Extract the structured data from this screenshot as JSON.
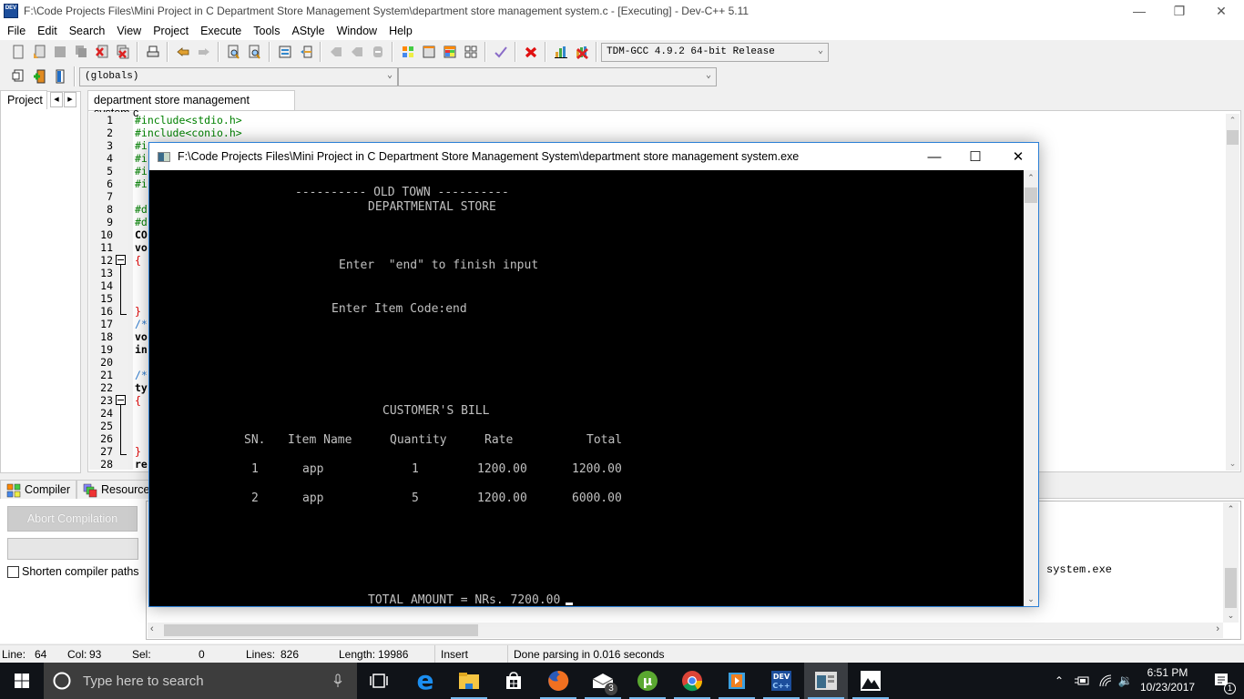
{
  "window": {
    "title": "F:\\Code Projects Files\\Mini Project in C Department Store Management System\\department store management system.c - [Executing] - Dev-C++ 5.11",
    "app_icon_text": "DEV"
  },
  "menu": [
    "File",
    "Edit",
    "Search",
    "View",
    "Project",
    "Execute",
    "Tools",
    "AStyle",
    "Window",
    "Help"
  ],
  "toolbar": {
    "compiler_select": "TDM-GCC 4.9.2 64-bit Release",
    "scope_select": "(globals)",
    "function_select": ""
  },
  "left_panel": {
    "tab_label": "Project"
  },
  "editor": {
    "tab_label": "department store management system.c",
    "lines": [
      {
        "n": "1",
        "code": "#include<stdio.h>",
        "cls": "pp"
      },
      {
        "n": "2",
        "code": "#include<conio.h>",
        "cls": "pp"
      },
      {
        "n": "3",
        "code": "#i",
        "cls": "pp"
      },
      {
        "n": "4",
        "code": "#i",
        "cls": "pp"
      },
      {
        "n": "5",
        "code": "#i",
        "cls": "pp"
      },
      {
        "n": "6",
        "code": "#i",
        "cls": "pp"
      },
      {
        "n": "7",
        "code": "",
        "cls": ""
      },
      {
        "n": "8",
        "code": "#d",
        "cls": "pp"
      },
      {
        "n": "9",
        "code": "#d",
        "cls": "pp"
      },
      {
        "n": "10",
        "code": "CO",
        "cls": "id"
      },
      {
        "n": "11",
        "code": "vo",
        "cls": "kw"
      },
      {
        "n": "12",
        "code": "{",
        "cls": "br"
      },
      {
        "n": "13",
        "code": "",
        "cls": ""
      },
      {
        "n": "14",
        "code": "",
        "cls": ""
      },
      {
        "n": "15",
        "code": "",
        "cls": ""
      },
      {
        "n": "16",
        "code": "}",
        "cls": "br"
      },
      {
        "n": "17",
        "code": "/*",
        "cls": "cm"
      },
      {
        "n": "18",
        "code": "vo",
        "cls": "kw"
      },
      {
        "n": "19",
        "code": "in",
        "cls": "kw"
      },
      {
        "n": "20",
        "code": "",
        "cls": ""
      },
      {
        "n": "21",
        "code": "/*",
        "cls": "cm"
      },
      {
        "n": "22",
        "code": "ty",
        "cls": "kw"
      },
      {
        "n": "23",
        "code": "{",
        "cls": "br"
      },
      {
        "n": "24",
        "code": "",
        "cls": ""
      },
      {
        "n": "25",
        "code": "",
        "cls": ""
      },
      {
        "n": "26",
        "code": "",
        "cls": ""
      },
      {
        "n": "27",
        "code": "}",
        "cls": "br"
      },
      {
        "n": "28",
        "code": "re",
        "cls": "id"
      }
    ]
  },
  "bottom_panel": {
    "tabs": [
      "Compiler",
      "Resources"
    ],
    "abort_button": "Abort Compilation",
    "shorten_paths_label": "Shorten compiler paths",
    "shorten_paths_checked": false,
    "log_text": "system.exe"
  },
  "statusbar": {
    "line_label": "Line:",
    "line": "64",
    "col_label": "Col:",
    "col": "93",
    "sel_label": "Sel:",
    "sel": "0",
    "lines_label": "Lines:",
    "lines": "826",
    "length_label": "Length:",
    "length": "19986",
    "mode": "Insert",
    "message": "Done parsing in 0.016 seconds"
  },
  "console": {
    "title": "F:\\Code Projects Files\\Mini Project in C Department Store Management System\\department store management system.exe",
    "header1": "---------- OLD TOWN ----------",
    "header2": "DEPARTMENTAL STORE",
    "instruction": "Enter  \"end\" to finish input",
    "prompt": "Enter Item Code:end",
    "bill_title": "CUSTOMER'S BILL",
    "columns": [
      "SN.",
      "Item Name",
      "Quantity",
      "Rate",
      "Total"
    ],
    "rows": [
      [
        "1",
        "app",
        "1",
        "1200.00",
        "1200.00"
      ],
      [
        "2",
        "app",
        "5",
        "1200.00",
        "6000.00"
      ]
    ],
    "total_line": "TOTAL AMOUNT = NRs. 7200.00"
  },
  "taskbar": {
    "search_placeholder": "Type here to search",
    "mail_badge": "3",
    "time": "6:51 PM",
    "date": "10/23/2017",
    "notification_badge": "1"
  }
}
